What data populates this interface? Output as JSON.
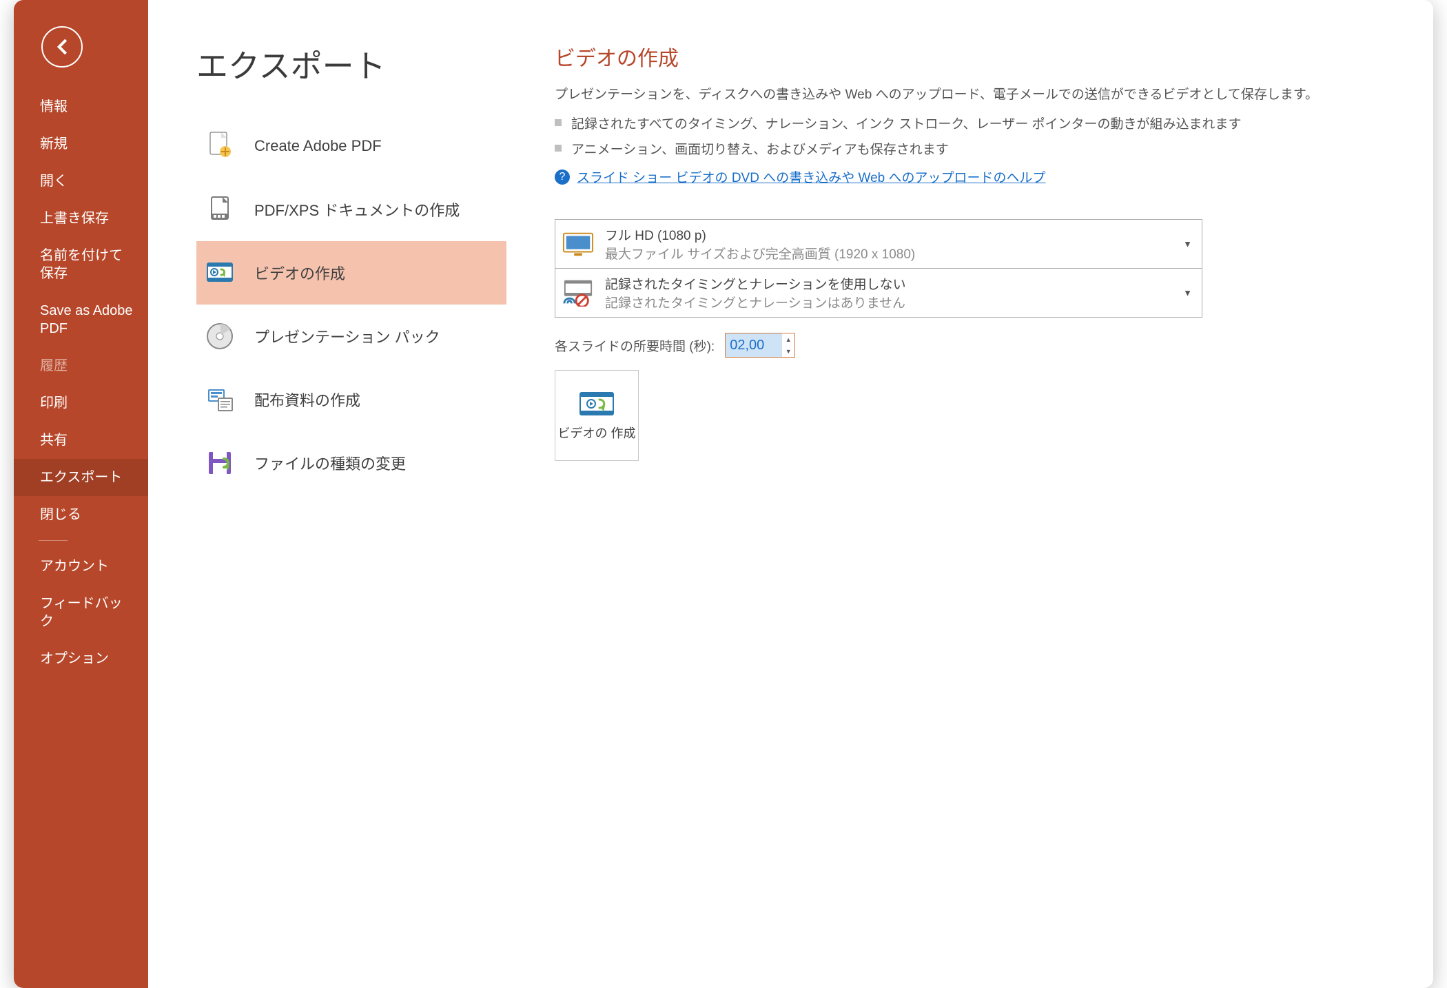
{
  "sidebar": {
    "items": [
      {
        "label": "情報"
      },
      {
        "label": "新規"
      },
      {
        "label": "開く"
      },
      {
        "label": "上書き保存"
      },
      {
        "label": "名前を付けて保存"
      },
      {
        "label": "Save as Adobe PDF"
      },
      {
        "label": "履歴"
      },
      {
        "label": "印刷"
      },
      {
        "label": "共有"
      },
      {
        "label": "エクスポート"
      },
      {
        "label": "閉じる"
      }
    ],
    "footer": [
      {
        "label": "アカウント"
      },
      {
        "label": "フィードバック"
      },
      {
        "label": "オプション"
      }
    ]
  },
  "page_title": "エクスポート",
  "export_options": [
    {
      "label": "Create Adobe PDF"
    },
    {
      "label": "PDF/XPS ドキュメントの作成"
    },
    {
      "label": "ビデオの作成"
    },
    {
      "label": "プレゼンテーション パック"
    },
    {
      "label": "配布資料の作成"
    },
    {
      "label": "ファイルの種類の変更"
    }
  ],
  "detail": {
    "title": "ビデオの作成",
    "desc": "プレゼンテーションを、ディスクへの書き込みや Web へのアップロード、電子メールでの送信ができるビデオとして保存します。",
    "bullets": [
      "記録されたすべてのタイミング、ナレーション、インク ストローク、レーザー ポインターの動きが組み込まれます",
      "アニメーション、画面切り替え、およびメディアも保存されます"
    ],
    "help_link": "スライド ショー ビデオの DVD への書き込みや Web へのアップロードのヘルプ",
    "quality": {
      "line1": "フル HD (1080 p)",
      "line2": "最大ファイル サイズおよび完全高画質 (1920 x 1080)"
    },
    "timing": {
      "line1": "記録されたタイミングとナレーションを使用しない",
      "line2": "記録されたタイミングとナレーションはありません"
    },
    "time_label": "各スライドの所要時間 (秒):",
    "time_value": "02,00",
    "create_label": "ビデオの\n作成"
  }
}
